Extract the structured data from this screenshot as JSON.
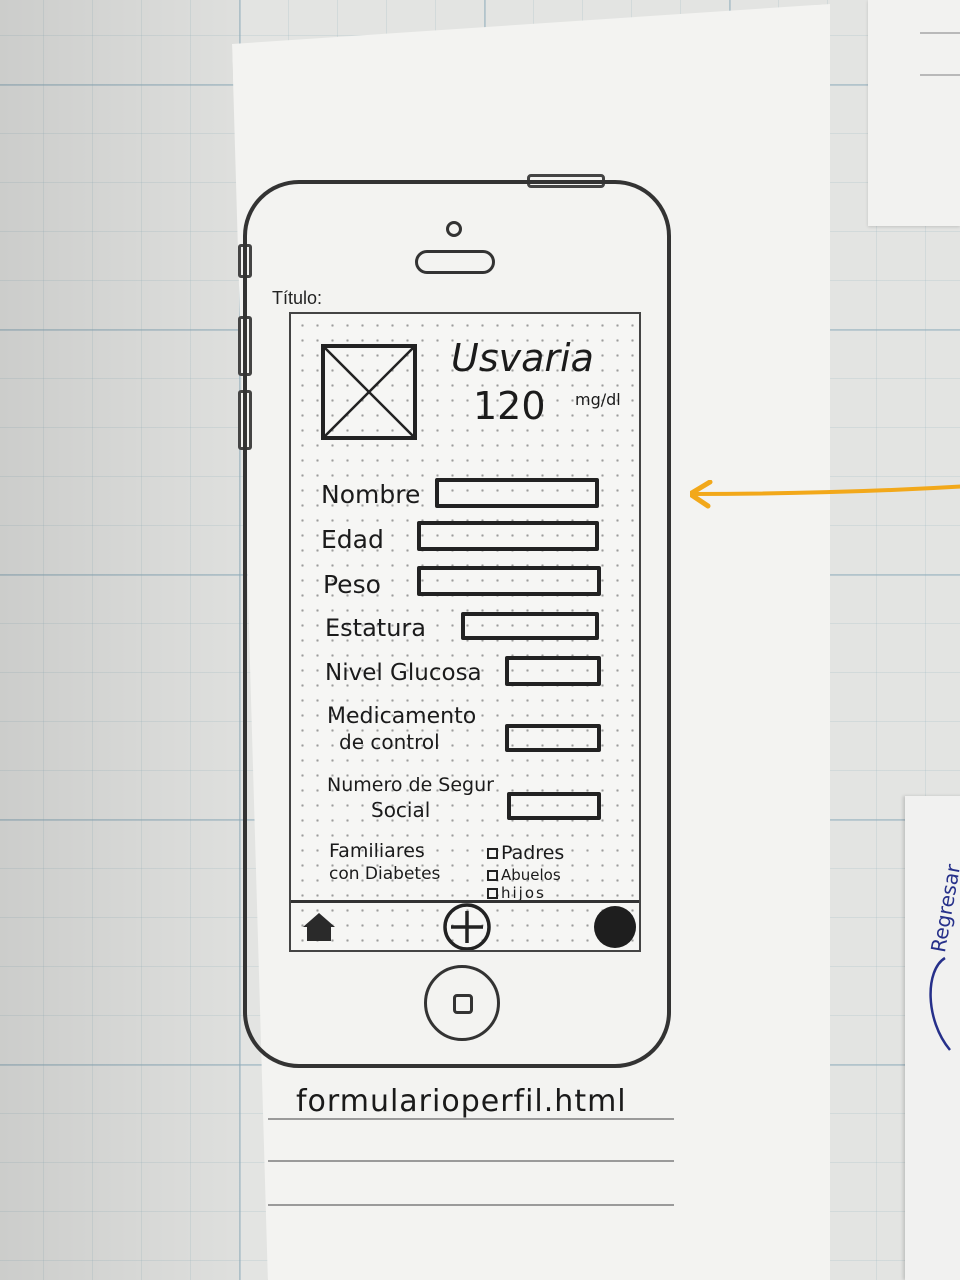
{
  "screen_title_label": "Título:",
  "profile": {
    "name": "Usvaria",
    "glucose_value": "120",
    "glucose_unit": "mg/dl",
    "avatar_icon": "image-placeholder-icon"
  },
  "form": {
    "fields": [
      {
        "label": "Nombre"
      },
      {
        "label": "Edad"
      },
      {
        "label": "Peso"
      },
      {
        "label": "Estatura"
      },
      {
        "label": "Nivel Glucosa"
      },
      {
        "label_line1": "Medicamento",
        "label_line2": "de control"
      },
      {
        "label_line1": "Numero de Segur",
        "label_line2": "Social"
      }
    ],
    "family": {
      "label_line1": "Familiares",
      "label_line2": "con Diabetes",
      "options": [
        "Padres",
        "Abuelos",
        "hijos"
      ]
    }
  },
  "tabbar": {
    "icons": [
      "home-icon",
      "add-icon",
      "profile-icon"
    ]
  },
  "filename": "formularioperfil.html",
  "side_note": "Regresar",
  "colors": {
    "arrow": "#f2a81a",
    "ink": "#1b1b1b",
    "side_note_ink": "#26308a"
  }
}
